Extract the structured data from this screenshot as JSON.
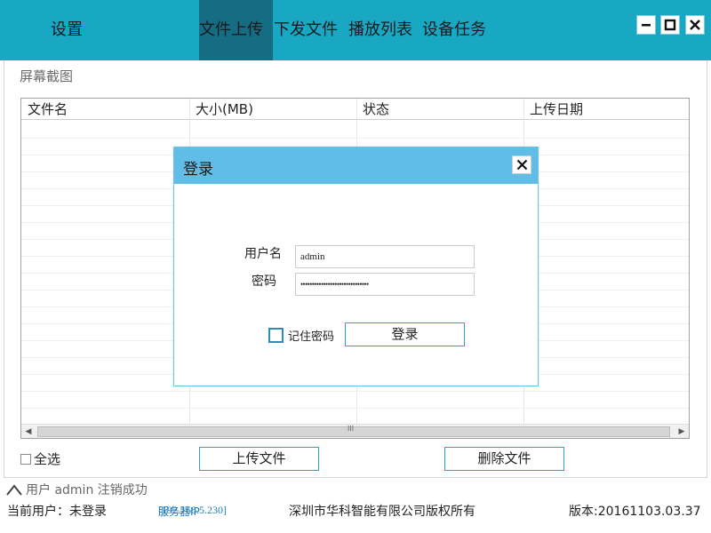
{
  "nav": {
    "settings": "设置",
    "upload": "文件上传",
    "distribute": "下发文件",
    "playlist": "播放列表",
    "device_task": "设备任务"
  },
  "window": {
    "minimize_icon": "minimize-icon",
    "maximize_icon": "maximize-icon",
    "close_icon": "close-icon"
  },
  "section": {
    "title": "屏幕截图"
  },
  "table": {
    "columns": [
      "文件名",
      "大小(MB)",
      "状态",
      "上传日期"
    ],
    "rows": [],
    "scroll_left": "◀",
    "scroll_right": "▶",
    "scroll_grip": "III"
  },
  "controls": {
    "select_all": "全选",
    "upload_btn": "上传文件",
    "delete_btn": "删除文件"
  },
  "status": {
    "message": "用户 admin 注销成功"
  },
  "footer": {
    "current_user": "当前用户：未登录",
    "server_label": "服务器IP",
    "server_ip": "[192.168.5.230]",
    "copyright": "深圳市华科智能有限公司版权所有",
    "version": "版本:20161103.03.37"
  },
  "login": {
    "title": "登录",
    "username_label": "用户名",
    "username_value": "admin",
    "password_label": "密码",
    "password_value": "••••••••••••••••••••••••••••••",
    "remember": "记住密码",
    "submit": "登录"
  },
  "colors": {
    "accent": "#18a8c4",
    "active_tab": "#146d82",
    "modal_header": "#5fbde8",
    "link": "#1e7fbf"
  }
}
